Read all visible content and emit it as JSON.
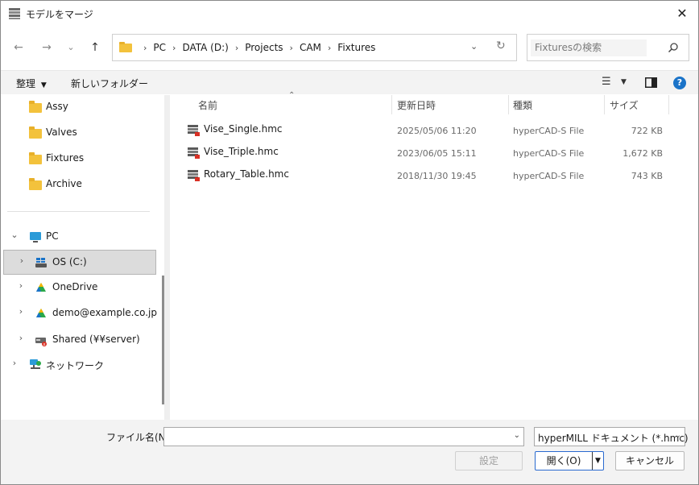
{
  "window": {
    "title": "モデルをマージ"
  },
  "address": {
    "crumbs": [
      "PC",
      "DATA (D:)",
      "Projects",
      "CAM",
      "Fixtures"
    ]
  },
  "search": {
    "placeholder": "Fixturesの検索"
  },
  "toolbar": {
    "organize": "整理",
    "new_folder": "新しいフォルダー"
  },
  "nav": {
    "folders": [
      "Assy",
      "Valves",
      "Fixtures",
      "Archive"
    ],
    "pc": "PC",
    "drive_c": "OS (C:)",
    "onedrive": "OneDrive",
    "account": "demo@example.co.jp",
    "shared": "Shared (¥¥server)",
    "network": "ネットワーク"
  },
  "columns": {
    "name": "名前",
    "date": "更新日時",
    "type": "種類",
    "size": "サイズ"
  },
  "files": [
    {
      "name": "Vise_Single.hmc",
      "date": "2025/05/06 11:20",
      "type": "hyperCAD-S File",
      "size": "722 KB"
    },
    {
      "name": "Vise_Triple.hmc",
      "date": "2023/06/05 15:11",
      "type": "hyperCAD-S File",
      "size": "1,672 KB"
    },
    {
      "name": "Rotary_Table.hmc",
      "date": "2018/11/30 19:45",
      "type": "hyperCAD-S File",
      "size": "743 KB"
    }
  ],
  "bottom": {
    "filename_label": "ファイル名(N):",
    "filename_value": "",
    "filter": "hyperMILL ドキュメント (*.hmc)",
    "settings": "設定",
    "open": "開く(O)",
    "cancel": "キャンセル"
  },
  "colors": {
    "accent": "#1a73c8",
    "folder": "#f3c23c",
    "selected": "#dcdcdc"
  }
}
